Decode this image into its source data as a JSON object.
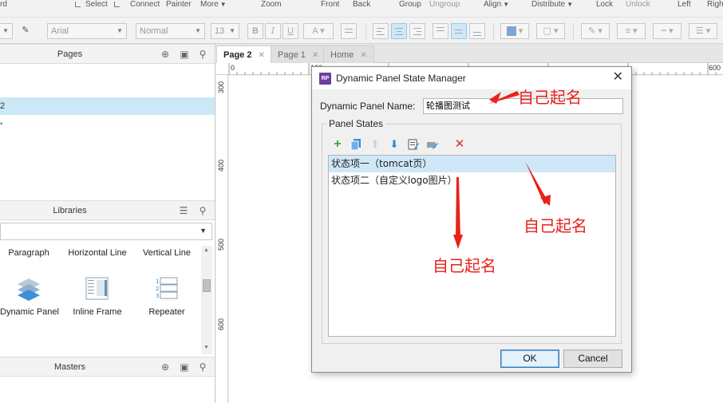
{
  "toolbar_top": {
    "items": [
      "Select",
      "Connect",
      "Painter",
      "More",
      "Zoom",
      "Front",
      "Back",
      "Group",
      "Ungroup",
      "Align",
      "Distribute",
      "Lock",
      "Unlock",
      "Left",
      "Righ"
    ],
    "partial_left": "rd"
  },
  "toolbar_format": {
    "font_family": "Arial",
    "font_weight": "Normal",
    "font_size": "13"
  },
  "pages_panel": {
    "title": "Pages",
    "selected_item_fragment": "2"
  },
  "libraries_panel": {
    "title": "Libraries",
    "widgets_row1": [
      "Paragraph",
      "Horizontal Line",
      "Vertical Line"
    ],
    "widgets_row2": [
      "Dynamic Panel",
      "Inline Frame",
      "Repeater"
    ]
  },
  "masters_panel": {
    "title": "Masters"
  },
  "tabs": [
    {
      "label": "Page 2",
      "active": true
    },
    {
      "label": "Page 1",
      "active": false
    },
    {
      "label": "Home",
      "active": false
    }
  ],
  "ruler": {
    "h": [
      "0",
      "100",
      "600"
    ],
    "v": [
      "300",
      "400",
      "500",
      "600"
    ]
  },
  "dialog": {
    "logo": "RP",
    "title": "Dynamic Panel State Manager",
    "name_label": "Dynamic Panel Name:",
    "name_value": "轮播图测试",
    "group_label": "Panel States",
    "states": [
      {
        "label": "状态项一（tomcat页）",
        "selected": true
      },
      {
        "label": "状态项二（自定义logo图片）",
        "selected": false
      }
    ],
    "ok_label": "OK",
    "cancel_label": "Cancel"
  },
  "annotations": {
    "name_note": "自己起名",
    "state1_note": "自己起名",
    "state2_note": "自己起名"
  },
  "colors": {
    "accent_selected": "#cfe8f7",
    "annotation_red": "#e8221b",
    "logo_purple": "#6b3fa0"
  }
}
